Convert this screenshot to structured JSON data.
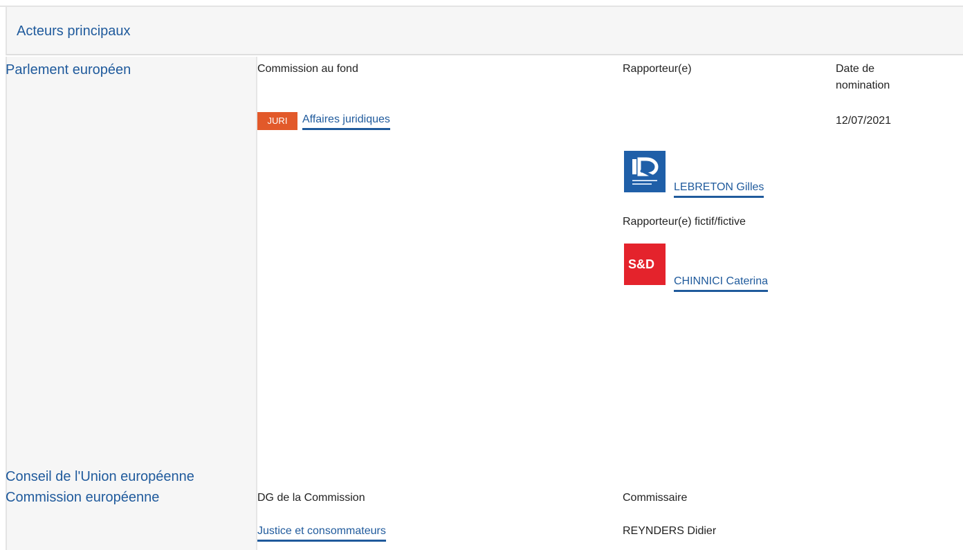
{
  "section_title": "Acteurs principaux",
  "parliament": {
    "institution": "Parlement européen",
    "committee_header": "Commission au fond",
    "rapporteur_header": "Rapporteur(e)",
    "date_header": "Date de nomination",
    "committee_badge": "JURI",
    "committee_name": "Affaires juridiques",
    "appointment_date": "12/07/2021",
    "rapporteur": {
      "name": "LEBRETON Gilles",
      "group_logo": "id-group-logo",
      "logo_color": "#1f5fa8"
    },
    "shadow_header": "Rapporteur(e) fictif/fictive",
    "shadow_rapporteur": {
      "name": "CHINNICI Caterina",
      "group_logo": "sd-group-logo",
      "logo_text": "S&D",
      "logo_color": "#e4232c"
    }
  },
  "council": {
    "institution": "Conseil de l'Union européenne"
  },
  "commission": {
    "institution": "Commission européenne",
    "dg_header": "DG de la Commission",
    "commissioner_header": "Commissaire",
    "dg_name": "Justice et consommateurs",
    "commissioner_name": "REYNDERS Didier"
  },
  "colors": {
    "link": "#1f5a9c",
    "badge": "#e2592a",
    "panel": "#f6f6f6"
  }
}
